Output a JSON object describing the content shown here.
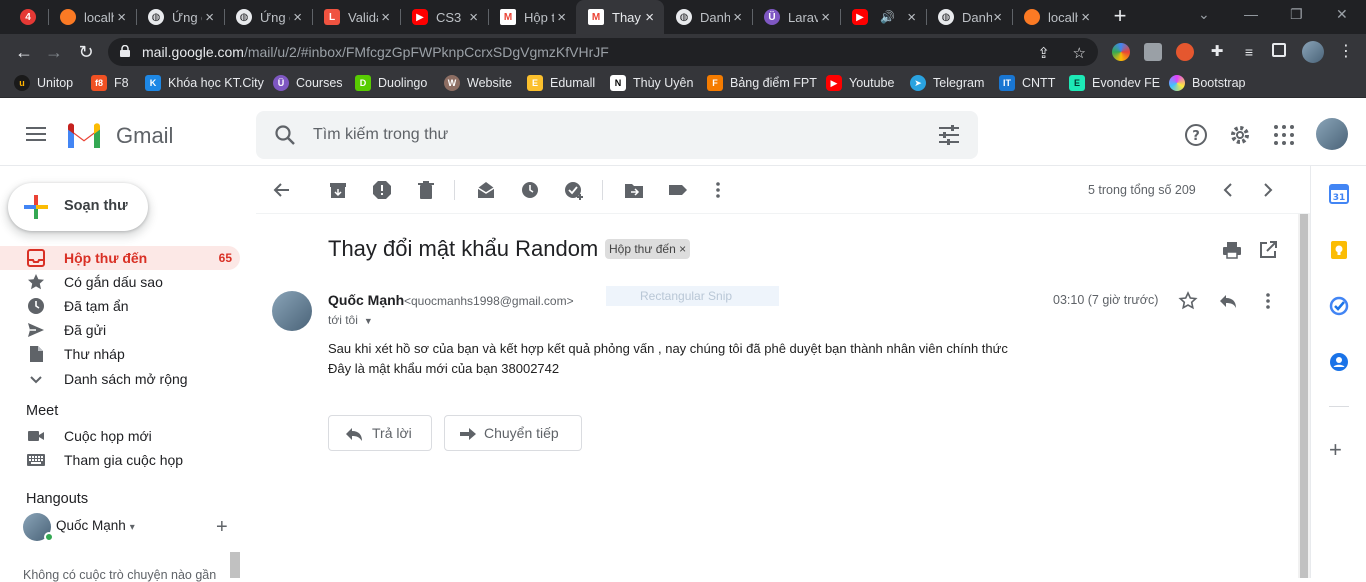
{
  "browser": {
    "tabs": [
      {
        "title": "",
        "icon": "notification-badge-icon",
        "badge": "4",
        "color": "#e53935"
      },
      {
        "title": "localhost",
        "icon": "xampp-icon",
        "color": "#fb7a24"
      },
      {
        "title": "Ứng dụng",
        "icon": "globe-icon",
        "color": "#9aa0a6"
      },
      {
        "title": "Ứng dụng",
        "icon": "globe-icon",
        "color": "#9aa0a6"
      },
      {
        "title": "Validation",
        "icon": "laravel-icon",
        "color": "#f05340"
      },
      {
        "title": "CS3",
        "icon": "youtube-icon",
        "color": "#ff0000"
      },
      {
        "title": "Hộp thư",
        "icon": "gmail-icon",
        "color": "#ea4335"
      },
      {
        "title": "Thay đổi",
        "icon": "gmail-icon",
        "color": "#ea4335",
        "active": true
      },
      {
        "title": "Danh",
        "icon": "globe-icon",
        "color": "#9aa0a6"
      },
      {
        "title": "Laravel",
        "icon": "ufo-icon",
        "color": "#7e57c2"
      },
      {
        "title": "",
        "icon": "youtube-icon",
        "color": "#ff0000",
        "audio": true
      },
      {
        "title": "Danh",
        "icon": "globe-icon",
        "color": "#9aa0a6"
      },
      {
        "title": "localhost",
        "icon": "xampp-icon",
        "color": "#fb7a24"
      }
    ],
    "url_host": "mail.google.com",
    "url_path": "/mail/u/2/#inbox/FMfcgzGpFWPknpCcrxSDgVgmzKfVHrJF",
    "bookmarks": [
      {
        "label": "Unitop",
        "icon": "unitop-icon",
        "color": "#1a1a1a",
        "glyph": "u"
      },
      {
        "label": "F8",
        "icon": "f8-icon",
        "color": "#f05123",
        "glyph": "f8"
      },
      {
        "label": "Khóa học KT.City",
        "icon": "ktcity-icon",
        "color": "#1e88e5",
        "glyph": "K"
      },
      {
        "label": "Courses",
        "icon": "courses-icon",
        "color": "#7e57c2",
        "glyph": "Ü"
      },
      {
        "label": "Duolingo",
        "icon": "duolingo-icon",
        "color": "#58cc02",
        "glyph": "D"
      },
      {
        "label": "Website",
        "icon": "website-icon",
        "color": "#8d6e63",
        "glyph": "W"
      },
      {
        "label": "Edumall",
        "icon": "edumall-icon",
        "color": "#fbc02d",
        "glyph": "E"
      },
      {
        "label": "Thùy Uyên",
        "icon": "notion-icon",
        "color": "#ffffff",
        "glyph": "N"
      },
      {
        "label": "Bảng điểm FPT",
        "icon": "fpt-icon",
        "color": "#f57c00",
        "glyph": "F"
      },
      {
        "label": "Youtube",
        "icon": "youtube-icon",
        "color": "#ff0000",
        "glyph": "▶"
      },
      {
        "label": "Telegram",
        "icon": "telegram-icon",
        "color": "#2aa3e0",
        "glyph": "➤"
      },
      {
        "label": "CNTT",
        "icon": "cntt-icon",
        "color": "#1976d2",
        "glyph": "IT"
      },
      {
        "label": "Evondev FE",
        "icon": "evondev-icon",
        "color": "#1de9b6",
        "glyph": "E"
      },
      {
        "label": "Bootstrap",
        "icon": "bootstrap-icon",
        "color": "#e040fb",
        "glyph": "B"
      }
    ]
  },
  "gmail": {
    "brand": "Gmail",
    "search_placeholder": "Tìm kiếm trong thư",
    "compose_label": "Soạn thư",
    "nav": [
      {
        "label": "Hộp thư đến",
        "count": "65",
        "icon": "inbox-icon",
        "active": true
      },
      {
        "label": "Có gắn dấu sao",
        "icon": "star-icon"
      },
      {
        "label": "Đã tạm ẩn",
        "icon": "clock-icon"
      },
      {
        "label": "Đã gửi",
        "icon": "send-icon"
      },
      {
        "label": "Thư nháp",
        "icon": "draft-icon"
      },
      {
        "label": "Danh sách mở rộng",
        "icon": "chevron-down-icon"
      }
    ],
    "meet": {
      "title": "Meet",
      "items": [
        {
          "label": "Cuộc họp mới",
          "icon": "video-icon"
        },
        {
          "label": "Tham gia cuộc họp",
          "icon": "keyboard-icon"
        }
      ]
    },
    "hangouts": {
      "title": "Hangouts",
      "user": "Quốc Mạnh",
      "empty_text": "Không có cuộc trò chuyện nào gần"
    },
    "pager": "5 trong tổng số 209",
    "email": {
      "subject": "Thay đổi mật khẩu Random",
      "label": "Hộp thư đến",
      "sender_name": "Quốc Mạnh",
      "sender_email": "<quocmanhs1998@gmail.com>",
      "to": "tới tôi",
      "time": "03:10 (7 giờ trước)",
      "body": [
        "Sau khi xét hồ sơ của bạn và kết hợp kết quả phỏng vấn , nay chúng tôi đã phê duyệt bạn thành nhân viên chính thức",
        "Đây là mật khẩu mới của bạn 38002742"
      ],
      "reply_label": "Trả lời",
      "forward_label": "Chuyển tiếp"
    },
    "snip_overlay": "Rectangular Snip"
  }
}
